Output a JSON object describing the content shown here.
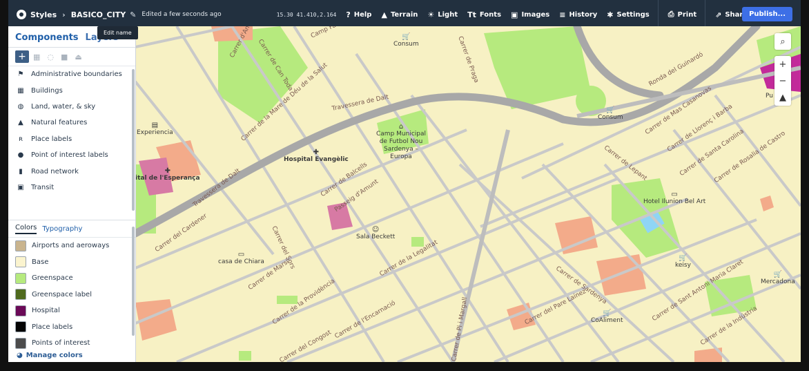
{
  "topbar": {
    "app": "Styles",
    "style_name": "BASICO_CITY",
    "edited": "Edited a few seconds ago",
    "coords": "15.30 41.410,2.164",
    "items": [
      {
        "label": "Help",
        "icon": "question-icon"
      },
      {
        "label": "Terrain",
        "icon": "mountain-icon"
      },
      {
        "label": "Light",
        "icon": "sun-icon"
      },
      {
        "label": "Fonts",
        "icon": "font-icon"
      },
      {
        "label": "Images",
        "icon": "image-icon"
      },
      {
        "label": "History",
        "icon": "history-icon"
      },
      {
        "label": "Settings",
        "icon": "gear-icon"
      },
      {
        "label": "Print",
        "icon": "print-icon"
      },
      {
        "label": "Share...",
        "icon": "share-icon"
      }
    ],
    "publish": "Publish...",
    "accent": "#3d6fe6",
    "bar_color": "#22303f"
  },
  "tooltip": "Edit name",
  "sidebar": {
    "tabs": [
      "Components",
      "Layers"
    ],
    "components": [
      {
        "label": "Administrative boundaries",
        "icon": "flag-icon"
      },
      {
        "label": "Buildings",
        "icon": "building-icon"
      },
      {
        "label": "Land, water, & sky",
        "icon": "globe-icon"
      },
      {
        "label": "Natural features",
        "icon": "mountain-icon"
      },
      {
        "label": "Place labels",
        "icon": "place-label-icon"
      },
      {
        "label": "Point of interest labels",
        "icon": "pin-icon"
      },
      {
        "label": "Road network",
        "icon": "road-icon"
      },
      {
        "label": "Transit",
        "icon": "bus-icon"
      }
    ],
    "sub_tabs": [
      "Colors",
      "Typography"
    ],
    "colors": [
      {
        "label": "Airports and aeroways",
        "color": "#c9b48e"
      },
      {
        "label": "Base",
        "color": "#fbf4cf"
      },
      {
        "label": "Greenspace",
        "color": "#b6ea7e"
      },
      {
        "label": "Greenspace label",
        "color": "#4f6a1e"
      },
      {
        "label": "Hospital",
        "color": "#6b0a57"
      },
      {
        "label": "Place labels",
        "color": "#050505"
      },
      {
        "label": "Points of interest",
        "color": "#4c4c4c"
      }
    ],
    "manage": "Manage colors"
  },
  "map": {
    "places": [
      "Experiencia",
      "Hospital Evangèlic",
      "ital de l'Esperança",
      "Sala Beckett",
      "casa de Chiara",
      "Hotel Ilunion Bel Art",
      "keisy",
      "Mercadona",
      "CoAliment",
      "Consum",
      "Consum",
      "Camp Municipal de Futbol Nou Sardenya – Europa",
      "Pu"
    ],
    "streets": [
      "Travessera de Dalt",
      "Travessera de Dalt",
      "Carrer de Can Toda",
      "Carrer d'Antequera",
      "Carrer de la Mare de Déu de la Salut",
      "Carrer de Balcells",
      "Passeig d'Amunt",
      "Carrer del Cardener",
      "Carrer del Sors",
      "Carrer de Marsí",
      "Carrer de la Providència",
      "Carrer de l'Encarnació",
      "Carrer de la Legalitat",
      "Carrer de Pi i Margall",
      "Carrer del Pare Laínez",
      "Carrer de Sardenya",
      "Carrer de Lepant",
      "Carrer de Sant Antoni Maria Claret",
      "Carrer de la Indústria",
      "Ronda del Guinardó",
      "Carrer de Mas Casanovas",
      "Carrer de Llorenç i Barba",
      "Carrer de Santa Carolina",
      "Carrer de Rosalia de Castro",
      "Carrer del Congost",
      "Camp Fabra",
      "Carrer de Praga"
    ],
    "controls": [
      "search-icon",
      "zoom-in",
      "zoom-out",
      "compass"
    ]
  }
}
